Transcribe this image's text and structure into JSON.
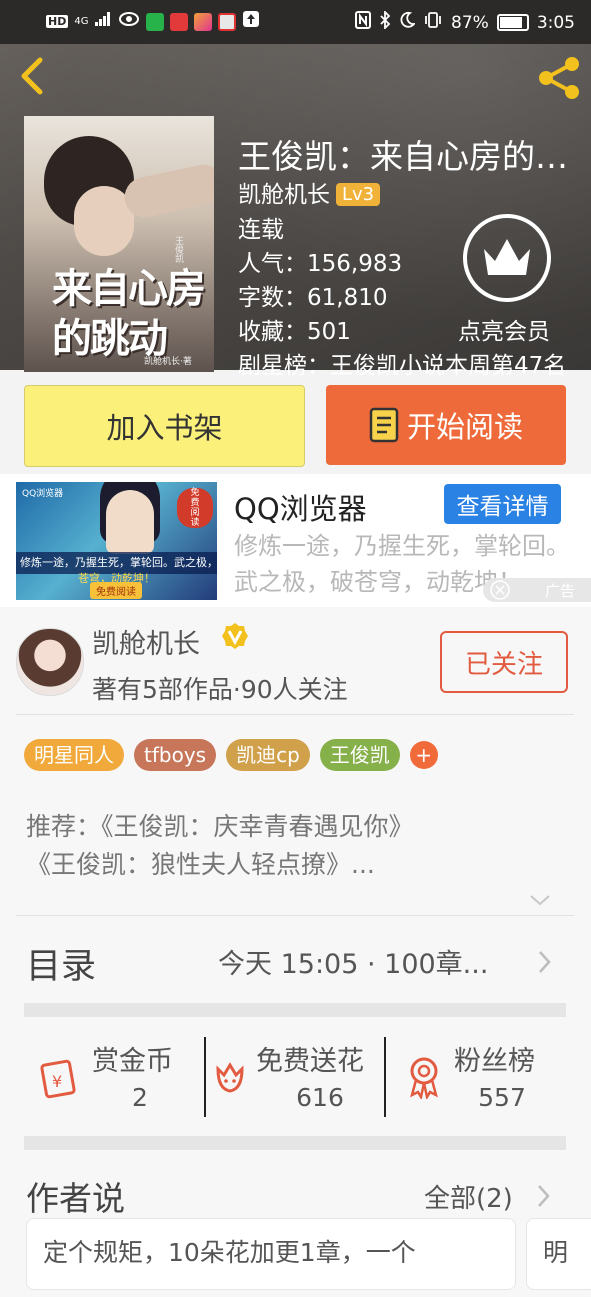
{
  "status_bar": {
    "left_icons": [
      "hd-icon",
      "signal-icon",
      "eye-icon",
      "app-icon-green",
      "mic-icon",
      "video-app-icon",
      "news-app-icon",
      "upload-icon"
    ],
    "hd": "HD",
    "net": "4G",
    "right_icons": [
      "nfc-icon",
      "bluetooth-icon",
      "moon-icon",
      "vibrate-icon"
    ],
    "battery": "87%",
    "time": "3:05"
  },
  "book": {
    "title": "王俊凯：来自心房的跳动",
    "author": "凯舱机长",
    "level": "Lv3",
    "status": "连载",
    "popularity": "人气：156,983",
    "words": "字数：61,810",
    "favorites": "收藏：501",
    "ranking": "剧星榜：王俊凯小说本周第47名",
    "cover_title_line1": "来自心房",
    "cover_title_line2": "的跳动",
    "cover_small_top": "王俊凯",
    "cover_small_author": "凯舱机长·著",
    "vip_label": "点亮会员"
  },
  "actions": {
    "add_shelf": "加入书架",
    "start_read": "开始阅读"
  },
  "ad": {
    "title": "QQ浏览器",
    "button": "查看详情",
    "description": "修炼一途，乃握生死，掌轮回。 武之极，破苍穹，动乾坤！",
    "image_logo": "QQ浏览器",
    "image_tag": "免费阅读",
    "image_band": "修炼一途，乃握生死，掌轮回。武之极，破",
    "image_band2": "苍穹，动乾坤！",
    "image_free": "免费阅读",
    "mark": "广告"
  },
  "author": {
    "name": "凯舱机长",
    "info": "著有5部作品·90人关注",
    "follow": "已关注"
  },
  "tags": [
    {
      "label": "明星同人",
      "color": "#f0a93a"
    },
    {
      "label": "tfboys",
      "color": "#c8765a"
    },
    {
      "label": "凯迪cp",
      "color": "#d0a04a"
    },
    {
      "label": "王俊凯",
      "color": "#86b04a"
    }
  ],
  "tag_more": "+",
  "recommend": {
    "line1": "推荐：《王俊凯：庆幸青春遇见你》",
    "line2": "《王俊凯：狼性夫人轻点撩》..."
  },
  "toc": {
    "label": "目录",
    "info": "今天 15:05 · 100章..."
  },
  "stats": [
    {
      "label": "赏金币",
      "value": "2",
      "icon": "red-envelope-icon"
    },
    {
      "label": "免费送花",
      "value": "616",
      "icon": "flower-icon"
    },
    {
      "label": "粉丝榜",
      "value": "557",
      "icon": "medal-icon"
    }
  ],
  "author_says": {
    "title": "作者说",
    "all": "全部(2)",
    "cards": [
      "定个规矩，10朵花加更1章，一个",
      "明"
    ]
  },
  "colors": {
    "accent": "#ef6a3a",
    "shelf": "#fbf07a",
    "ad_button": "#2a82e4",
    "level_badge": "#f0b238"
  }
}
